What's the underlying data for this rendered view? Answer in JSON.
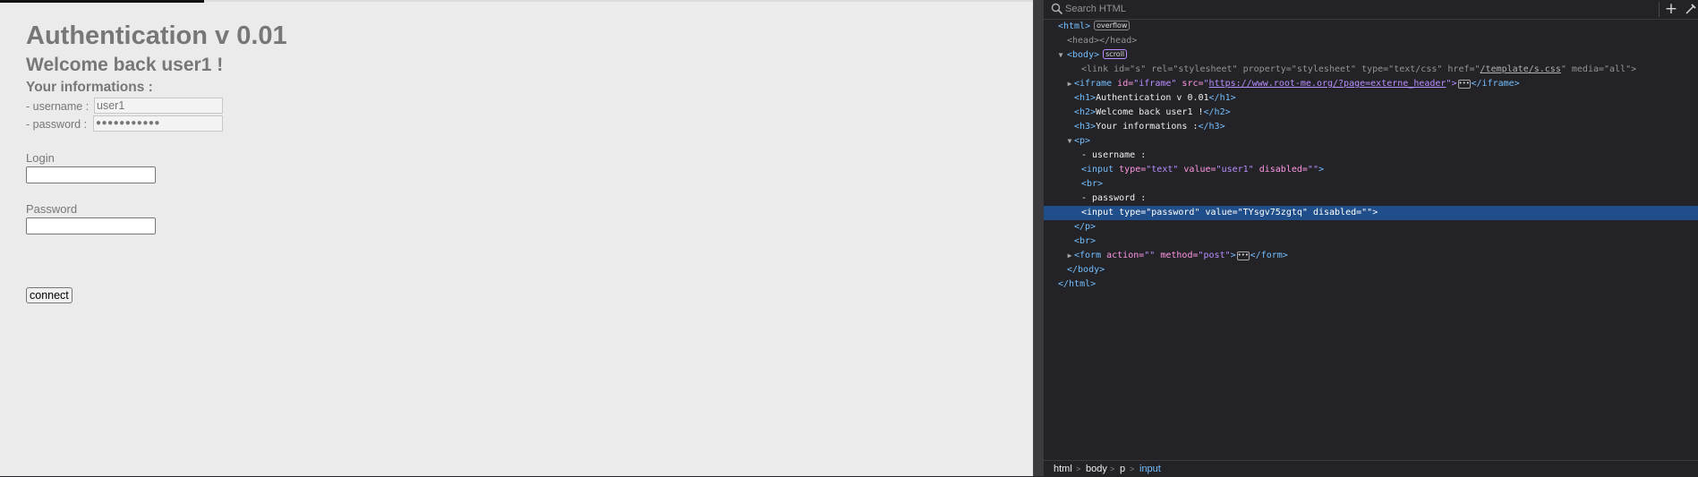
{
  "page": {
    "h1": "Authentication v 0.01",
    "h2": "Welcome back user1 !",
    "h3": "Your informations :",
    "username_label": "- username :",
    "username_value": "user1",
    "password_label": "- password :",
    "password_masked": "●●●●●●●●●●●",
    "login_label": "Login",
    "password_field_label": "Password",
    "connect_label": "connect"
  },
  "devtools": {
    "search_placeholder": "Search HTML",
    "lines": [
      {
        "t1": "<html>",
        "badge": "overflow"
      },
      {
        "t1": "<head></head>"
      },
      {
        "t1": "<body>",
        "badge": "scroll"
      },
      {
        "link_start": "<link ",
        "link_attrs": "id=\"s\" rel=\"stylesheet\" property=\"stylesheet\" type=\"text/css\" href=\"",
        "link_href": "/template/s.css",
        "link_end": "\" media=\"all\">"
      },
      {
        "a": "<iframe ",
        "b": "id=",
        "c": "\"iframe\"",
        "d": " src=",
        "e": "\"",
        "url": "https://www.root-me.org/?page=externe_header",
        "f": "\">",
        "g": "</iframe>"
      },
      {
        "open": "<h1>",
        "text": "Authentication v 0.01",
        "close": "</h1>"
      },
      {
        "open": "<h2>",
        "text": "Welcome back user1 !",
        "close": "</h2>"
      },
      {
        "open": "<h3>",
        "text": "Your informations :",
        "close": "</h3>"
      },
      {
        "t1": "<p>"
      },
      {
        "text": "- username :"
      },
      {
        "a": "<input ",
        "b": "type=",
        "c": "\"text\"",
        "d": " value=",
        "e": "\"user1\"",
        "f": " disabled=",
        "g": "\"\"",
        "h": ">"
      },
      {
        "t1": "<br>"
      },
      {
        "text": "- password :"
      },
      {
        "a": "<input ",
        "b": "type=",
        "c": "\"password\"",
        "d": " value=",
        "e": "\"TYsgv75zgtq\"",
        "f": " disabled=",
        "g": "\"\"",
        "h": ">"
      },
      {
        "t1": "</p>"
      },
      {
        "t1": "<br>"
      },
      {
        "a": "<form ",
        "b": "action=",
        "c": "\"\"",
        "d": " method=",
        "e": "\"post\"",
        "f": ">",
        "g": "</form>"
      },
      {
        "t1": "</body>"
      },
      {
        "t1": "</html>"
      }
    ],
    "breadcrumbs": [
      "html",
      "body",
      "p",
      "input"
    ]
  },
  "colors": {
    "page_bg": "#ebebeb",
    "devtools_bg": "#232327",
    "tag": "#75bfff",
    "attr_name": "#ff97e2",
    "attr_value": "#b98eff",
    "selected_row": "#204e8a"
  },
  "icons": {
    "search": "search-icon",
    "add": "plus-icon",
    "picker": "eyedropper-icon",
    "expand": "triangle-right-icon",
    "collapse": "triangle-down-icon"
  }
}
